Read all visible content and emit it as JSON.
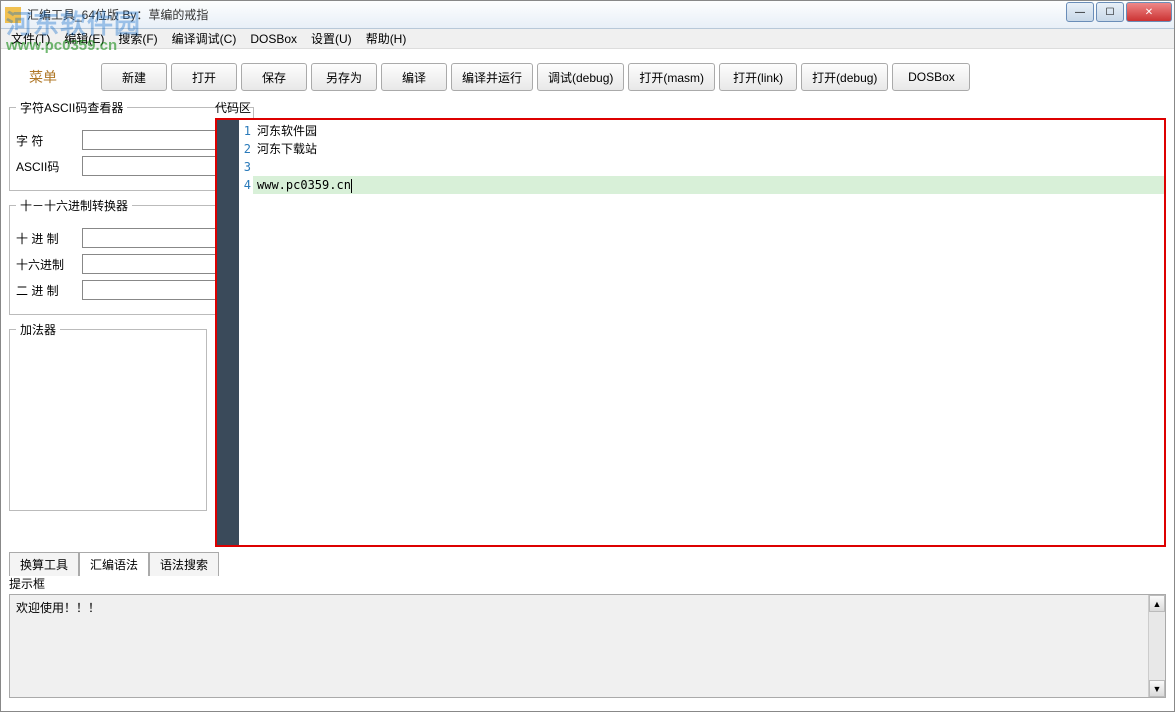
{
  "window": {
    "title": "汇编工具_64位版  By：草编的戒指"
  },
  "watermark": {
    "logo": "河东软件园",
    "url": "www.pc0359.cn"
  },
  "menu": {
    "file": "文件(T)",
    "edit": "编辑(E)",
    "search": "搜索(F)",
    "compile": "编译调试(C)",
    "dosbox": "DOSBox",
    "settings": "设置(U)",
    "help": "帮助(H)"
  },
  "menu_label": "菜单",
  "toolbar": {
    "new": "新建",
    "open": "打开",
    "save": "保存",
    "saveas": "另存为",
    "compile": "编译",
    "compile_run": "编译并运行",
    "debug": "调试(debug)",
    "open_masm": "打开(masm)",
    "open_link": "打开(link)",
    "open_debug": "打开(debug)",
    "dosbox": "DOSBox"
  },
  "sidebar": {
    "ascii_title": "字符ASCII码查看器",
    "char_label": "字    符",
    "ascii_label": "ASCII码",
    "char_value": "",
    "ascii_value": "",
    "conv_title": "十－十六进制转换器",
    "dec_label": "十 进 制",
    "hex_label": "十六进制",
    "bin_label": "二 进 制",
    "dec_value": "",
    "hex_value": "",
    "bin_value": "",
    "adder_title": "加法器"
  },
  "code": {
    "label": "代码区",
    "lines": [
      "河东软件园",
      "河东下载站",
      "",
      "www.pc0359.cn"
    ]
  },
  "tabs": {
    "t1": "换算工具",
    "t2": "汇编语法",
    "t3": "语法搜索"
  },
  "hint": {
    "label": "提示框",
    "text": "欢迎使用！！！"
  }
}
